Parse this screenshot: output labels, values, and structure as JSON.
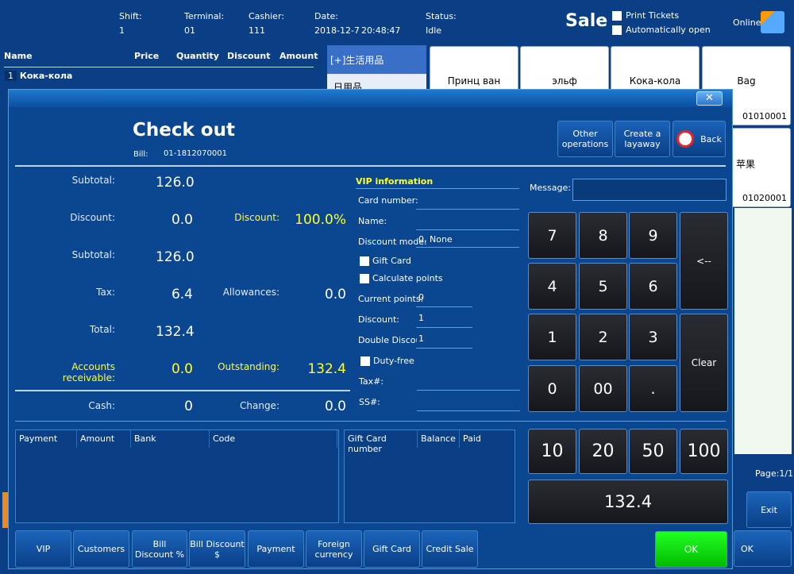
{
  "header": {
    "shift_label": "Shift:",
    "shift": "1",
    "terminal_label": "Terminal:",
    "terminal": "01",
    "cashier_label": "Cashier:",
    "cashier": "111",
    "date_label": "Date:",
    "date": "2018-12-7",
    "time": "20:48:47",
    "status_label": "Status:",
    "status": "Idle",
    "mode": "Sale",
    "print_tickets": "Print Tickets",
    "auto_open": "Automatically open",
    "online": "Online"
  },
  "cart": {
    "columns": [
      "Name",
      "Price",
      "Quantity",
      "Discount",
      "Amount"
    ],
    "rows": [
      {
        "index": "1",
        "name": "Кока-кола"
      }
    ]
  },
  "categories": [
    "[+]生活用品",
    "日用品"
  ],
  "products": [
    {
      "name": "Принц ван"
    },
    {
      "name": "эльф"
    },
    {
      "name": "Кока-кола"
    },
    {
      "name": "Bag",
      "code": "01010001"
    },
    {
      "name": "苹果",
      "code": "01020001"
    }
  ],
  "side": {
    "page": "Page:1/1",
    "exit": "Exit",
    "ok": "OK"
  },
  "dialog": {
    "title": "Check out",
    "bill_label": "Bill:",
    "bill": "01-1812070001",
    "buttons": {
      "other": "Other operations",
      "layaway": "Create a layaway",
      "back": "Back"
    },
    "summary": {
      "subtotal_label": "Subtotal:",
      "subtotal": "126.0",
      "discount_label": "Discount:",
      "discount": "0.0",
      "discount_pct_label": "Discount:",
      "discount_pct": "100.0%",
      "subtotal2_label": "Subtotal:",
      "subtotal2": "126.0",
      "tax_label": "Tax:",
      "tax": "6.4",
      "allowances_label": "Allowances:",
      "allowances": "0.0",
      "total_label": "Total:",
      "total": "132.4",
      "receivable_label": "Accounts receivable:",
      "receivable": "0.0",
      "outstanding_label": "Outstanding:",
      "outstanding": "132.4",
      "cash_label": "Cash:",
      "cash": "0",
      "change_label": "Change:",
      "change": "0.0"
    },
    "vip": {
      "title": "VIP information",
      "card_label": "Card number:",
      "card": "",
      "name_label": "Name:",
      "name": "",
      "mode_label": "Discount mode:",
      "mode": "0, None",
      "gift_card": "Gift Card",
      "calc_points": "Calculate points",
      "points_label": "Current points:",
      "points": "0",
      "discount_label": "Discount:",
      "discount": "1",
      "double_label": "Double Discount",
      "double": "1",
      "duty_free": "Duty-free",
      "tax_label": "Tax#:",
      "tax": "",
      "ss_label": "SS#:",
      "ss": ""
    },
    "message_label": "Message:",
    "message": "",
    "keypad": [
      "7",
      "8",
      "9",
      "4",
      "5",
      "6",
      "1",
      "2",
      "3",
      "0",
      "00",
      "."
    ],
    "backspace": "<--",
    "clear": "Clear",
    "quick": [
      "10",
      "20",
      "50",
      "100"
    ],
    "amount": "132.4",
    "ok": "OK",
    "payments_columns": [
      "Payment",
      "Amount",
      "Bank",
      "Code"
    ],
    "giftcard_columns": [
      "Gift Card number",
      "Balance",
      "Paid"
    ],
    "bottom_buttons": [
      "VIP",
      "Customers",
      "Bill Discount %",
      "Bill Discount $",
      "Payment",
      "Foreign currency",
      "Gift Card",
      "Credit Sale"
    ]
  },
  "colors": {
    "background": "#0a3f86",
    "highlight": "#ffff33",
    "ok_green": "#11dd22"
  }
}
